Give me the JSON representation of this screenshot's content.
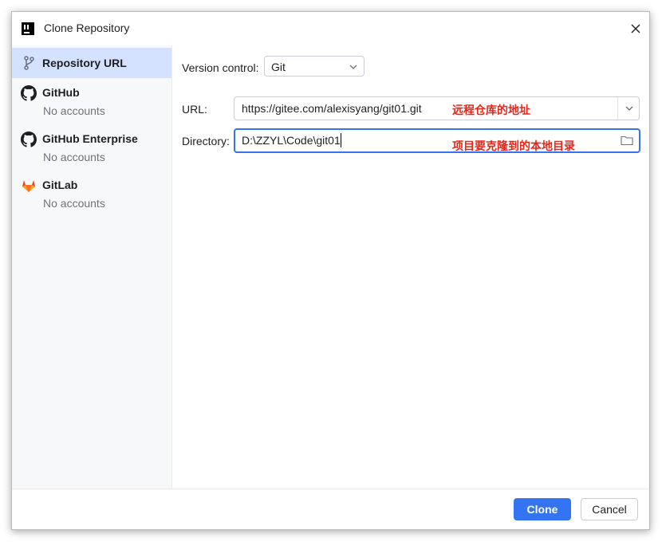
{
  "window": {
    "title": "Clone Repository"
  },
  "sidebar": {
    "items": [
      {
        "label": "Repository URL",
        "sub": "",
        "icon": "branch-icon"
      },
      {
        "label": "GitHub",
        "sub": "No accounts",
        "icon": "github-icon"
      },
      {
        "label": "GitHub Enterprise",
        "sub": "No accounts",
        "icon": "github-icon"
      },
      {
        "label": "GitLab",
        "sub": "No accounts",
        "icon": "gitlab-icon"
      }
    ]
  },
  "form": {
    "version_control_label": "Version control:",
    "version_control_value": "Git",
    "url_label": "URL:",
    "url_value": "https://gitee.com/alexisyang/git01.git",
    "directory_label": "Directory:",
    "directory_value": "D:\\ZZYL\\Code\\git01"
  },
  "annotations": {
    "url_note": "远程仓库的地址",
    "dir_note": "项目要克隆到的本地目录"
  },
  "buttons": {
    "clone": "Clone",
    "cancel": "Cancel"
  },
  "colors": {
    "accent": "#3574f0",
    "selected": "#d4e2ff",
    "annotation": "#e8261a"
  }
}
